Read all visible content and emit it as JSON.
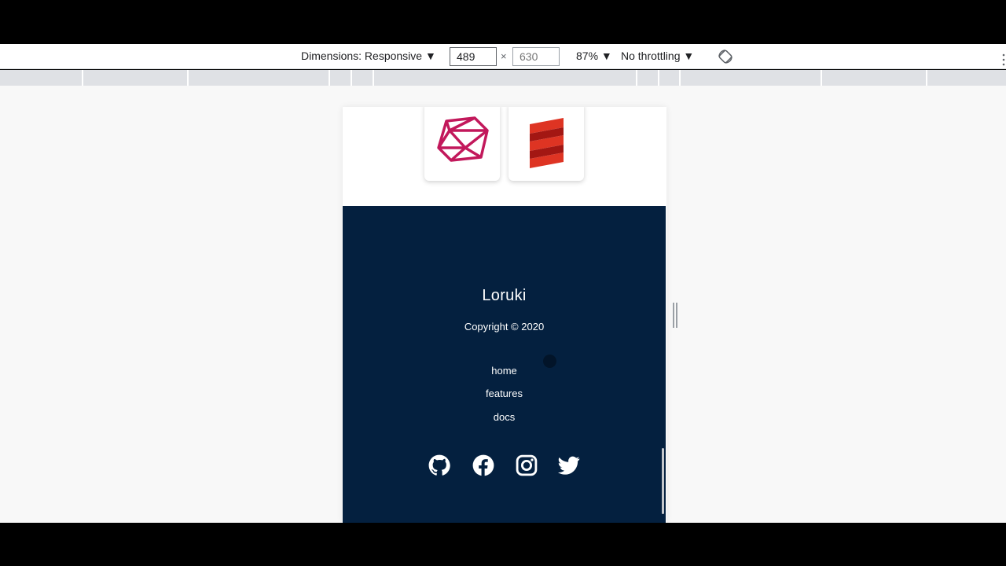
{
  "devtools": {
    "dimensions_label": "Dimensions: Responsive ▼",
    "width_value": "489",
    "times_symbol": "×",
    "height_placeholder": "630",
    "zoom_label": "87% ▼",
    "throttle_label": "No throttling ▼",
    "rotate_icon": "rotate-icon"
  },
  "tech_cards": [
    {
      "icon": "ruby-icon"
    },
    {
      "icon": "scala-icon"
    }
  ],
  "footer": {
    "brand": "Loruki",
    "copyright": "Copyright © 2020",
    "nav": [
      {
        "label": "home"
      },
      {
        "label": "features"
      },
      {
        "label": "docs"
      }
    ],
    "social": [
      "github-icon",
      "facebook-icon",
      "instagram-icon",
      "twitter-icon"
    ],
    "background_color": "#04203f"
  },
  "colors": {
    "ruby": "#c2185b",
    "scala": "#de3423"
  }
}
